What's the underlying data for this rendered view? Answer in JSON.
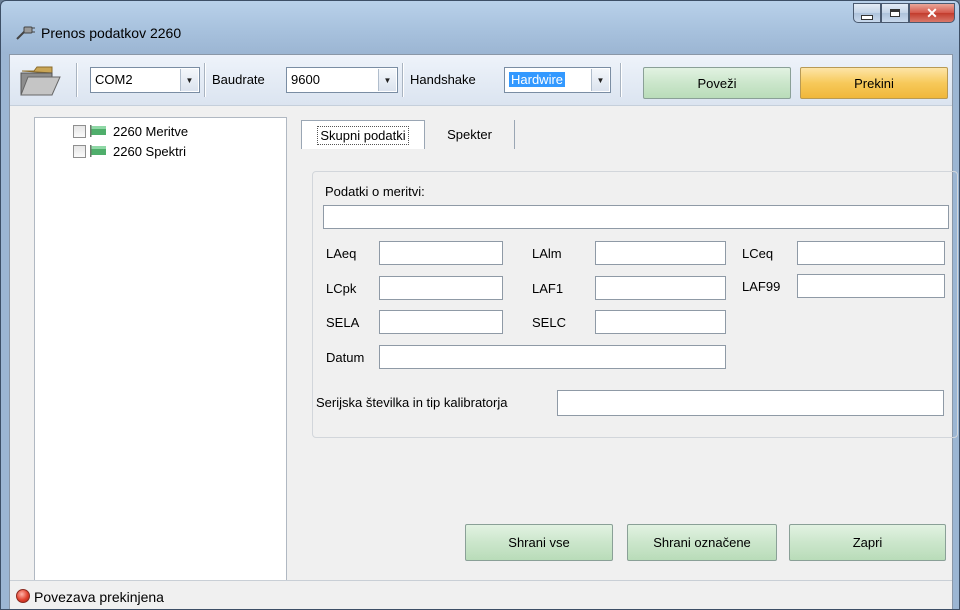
{
  "window": {
    "title": "Prenos podatkov 2260"
  },
  "toolbar": {
    "port_value": "COM2",
    "baudrate_label": "Baudrate",
    "baudrate_value": "9600",
    "handshake_label": "Handshake",
    "handshake_value": "Hardwire",
    "connect_label": "Poveži",
    "disconnect_label": "Prekini"
  },
  "tree": {
    "items": [
      {
        "label": "2260 Meritve"
      },
      {
        "label": "2260 Spektri"
      }
    ]
  },
  "tabs": [
    {
      "label": "Skupni podatki"
    },
    {
      "label": "Spekter"
    }
  ],
  "form": {
    "group_label": "Podatki o meritvi:",
    "fields": {
      "laeq": "LAeq",
      "lalm": "LAlm",
      "lceq": "LCeq",
      "lcpk": "LCpk",
      "laf1": "LAF1",
      "laf99": "LAF99",
      "sela": "SELA",
      "selc": "SELC",
      "datum": "Datum"
    },
    "calibrator_label": "Serijska številka in tip kalibratorja"
  },
  "buttons": {
    "save_all": "Shrani vse",
    "save_selected": "Shrani označene",
    "close": "Zapri"
  },
  "status": {
    "text": "Povezava prekinjena"
  },
  "colors": {
    "status_led": "#e0412e",
    "disconnect_button": "#f7c95a",
    "button_green": "#cbe6cb",
    "selection": "#3399ff"
  },
  "icons": {
    "title": "plug-icon",
    "folder": "open-folder-icon",
    "tree_item": "flag-icon",
    "status": "red-led-icon"
  }
}
